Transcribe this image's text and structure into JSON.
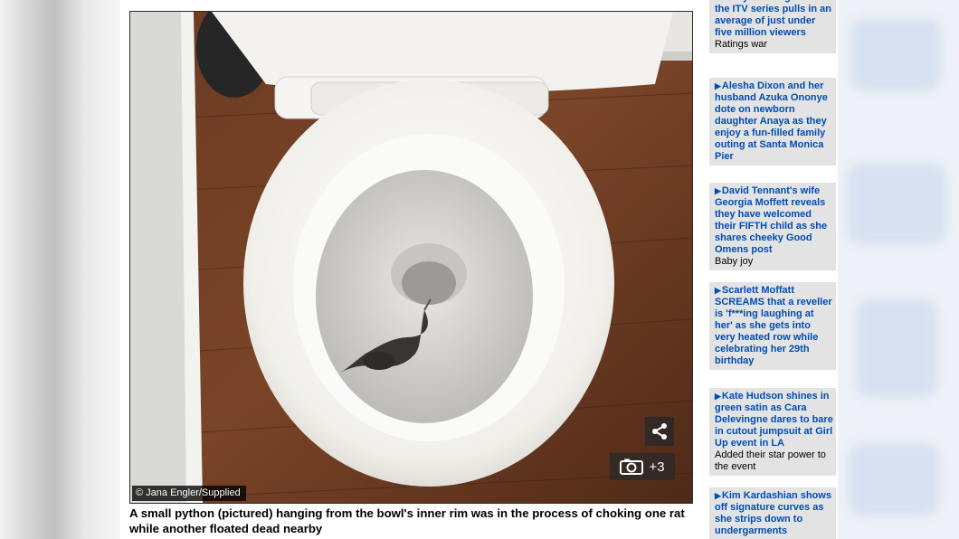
{
  "photo": {
    "credit": "© Jana Engler/Supplied",
    "gallery_count": "+3",
    "share_icon": "share-icon",
    "camera_icon": "camera-icon"
  },
  "caption": "A small python (pictured) hanging from the bowl's inner rim was in the process of choking one rat while another floated dead nearby",
  "sidebar": {
    "items": [
      {
        "title": "Strictly in ratings war as the ITV series pulls in an average of just under five million viewers",
        "subtitle": "Ratings war",
        "has_arrow": false
      },
      {
        "title": "Alesha Dixon and her husband Azuka Ononye dote on newborn daughter Anaya as they enjoy a fun-filled family outing at Santa Monica Pier",
        "subtitle": "",
        "has_arrow": true
      },
      {
        "title": "David Tennant's wife Georgia Moffett reveals they have welcomed their FIFTH child as she shares cheeky Good Omens post",
        "subtitle": "Baby joy",
        "has_arrow": true
      },
      {
        "title": "Scarlett Moffatt SCREAMS that a reveller is 'f***ing laughing at her' as she gets into very heated row while celebrating her 29th birthday",
        "subtitle": "",
        "has_arrow": true
      },
      {
        "title": "Kate Hudson shines in green satin as Cara Delevingne dares to bare in cutout jumpsuit at Girl Up event in LA",
        "subtitle": "Added their star power to the event",
        "has_arrow": true
      },
      {
        "title": "Kim Kardashian shows off signature curves as she strips down to undergarments",
        "subtitle": "",
        "has_arrow": true
      }
    ]
  },
  "colors": {
    "link": "#004db3",
    "teaser_bg": "#e3e3e3"
  }
}
